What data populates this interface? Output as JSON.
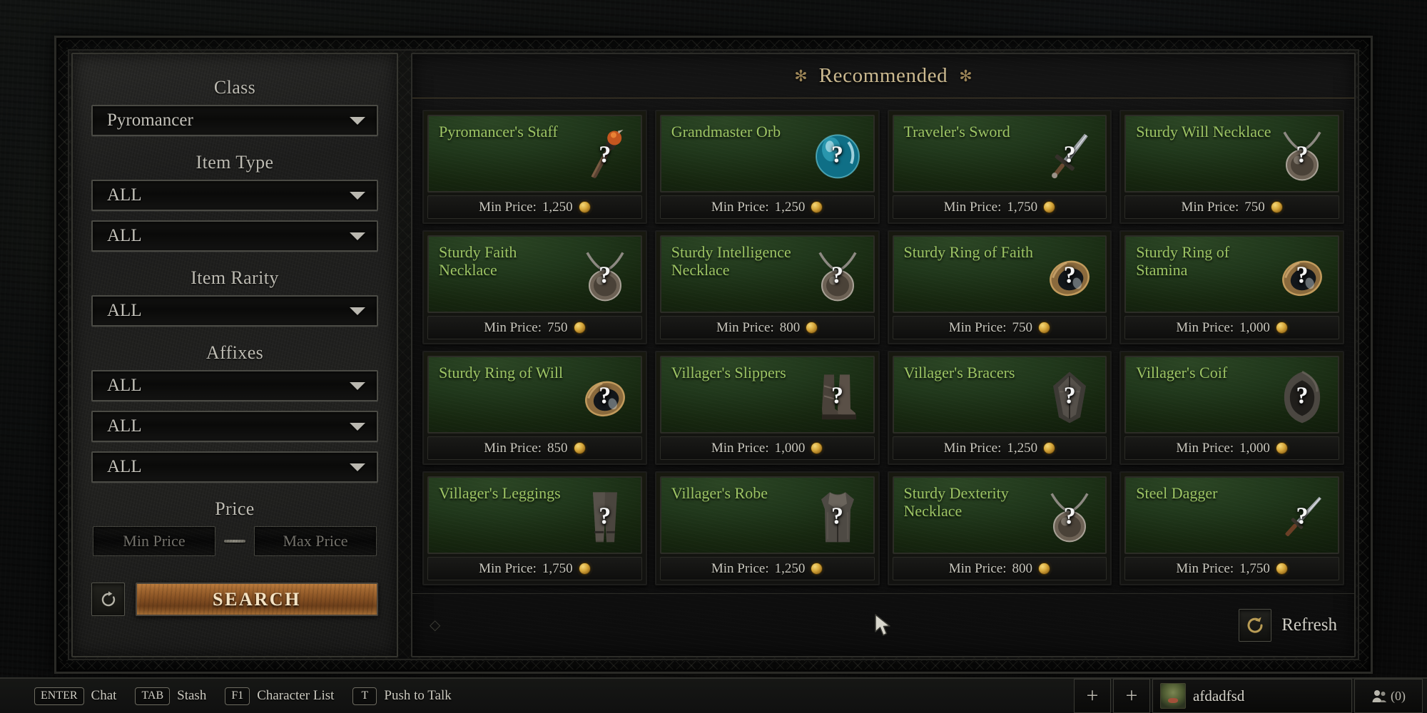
{
  "sidebar": {
    "groups": [
      {
        "label": "Class",
        "fields": [
          {
            "value": "Pyromancer"
          }
        ]
      },
      {
        "label": "Item Type",
        "fields": [
          {
            "value": "ALL"
          },
          {
            "value": "ALL"
          }
        ]
      },
      {
        "label": "Item Rarity",
        "fields": [
          {
            "value": "ALL"
          }
        ]
      },
      {
        "label": "Affixes",
        "fields": [
          {
            "value": "ALL"
          },
          {
            "value": "ALL"
          },
          {
            "value": "ALL"
          }
        ]
      }
    ],
    "price": {
      "label": "Price",
      "min_placeholder": "Min Price",
      "max_placeholder": "Max Price",
      "separator": "—"
    },
    "reset_icon": "reset-arrow-icon",
    "search_label": "SEARCH"
  },
  "results": {
    "title": "Recommended",
    "ornament": "✻",
    "price_prefix": "Min Price:",
    "refresh_label": "Refresh",
    "refresh_icon": "refresh-circular-arrow-icon",
    "footer_ornament": "◇",
    "cards": [
      {
        "name": "Pyromancer's Staff",
        "price": "1,250",
        "icon": "staff-icon"
      },
      {
        "name": "Grandmaster Orb",
        "price": "1,250",
        "icon": "orb-icon"
      },
      {
        "name": "Traveler's Sword",
        "price": "1,750",
        "icon": "sword-icon"
      },
      {
        "name": "Sturdy Will Necklace",
        "price": "750",
        "icon": "necklace-icon"
      },
      {
        "name": "Sturdy Faith Necklace",
        "price": "750",
        "icon": "necklace-icon"
      },
      {
        "name": "Sturdy Intelligence Necklace",
        "price": "800",
        "icon": "necklace-icon"
      },
      {
        "name": "Sturdy Ring of Faith",
        "price": "750",
        "icon": "ring-icon"
      },
      {
        "name": "Sturdy Ring of Stamina",
        "price": "1,000",
        "icon": "ring-icon"
      },
      {
        "name": "Sturdy Ring of Will",
        "price": "850",
        "icon": "ring-icon"
      },
      {
        "name": "Villager's Slippers",
        "price": "1,000",
        "icon": "boots-icon"
      },
      {
        "name": "Villager's Bracers",
        "price": "1,250",
        "icon": "bracers-icon"
      },
      {
        "name": "Villager's Coif",
        "price": "1,000",
        "icon": "hood-icon"
      },
      {
        "name": "Villager's Leggings",
        "price": "1,750",
        "icon": "leggings-icon"
      },
      {
        "name": "Villager's Robe",
        "price": "1,250",
        "icon": "robe-icon"
      },
      {
        "name": "Sturdy Dexterity Necklace",
        "price": "800",
        "icon": "necklace-icon"
      },
      {
        "name": "Steel Dagger",
        "price": "1,750",
        "icon": "dagger-icon"
      }
    ]
  },
  "hud": {
    "keybinds": [
      {
        "key": "ENTER",
        "action": "Chat"
      },
      {
        "key": "TAB",
        "action": "Stash"
      },
      {
        "key": "F1",
        "action": "Character List"
      },
      {
        "key": "T",
        "action": "Push to Talk"
      }
    ],
    "slots": [
      "+",
      "+"
    ],
    "player_name": "afdadfsd",
    "social_count": "(0)"
  },
  "colors": {
    "card_name": "#9dc464",
    "accent_gold": "#cbb98f",
    "search_button": "#8d5626",
    "card_green": "#20371b"
  }
}
